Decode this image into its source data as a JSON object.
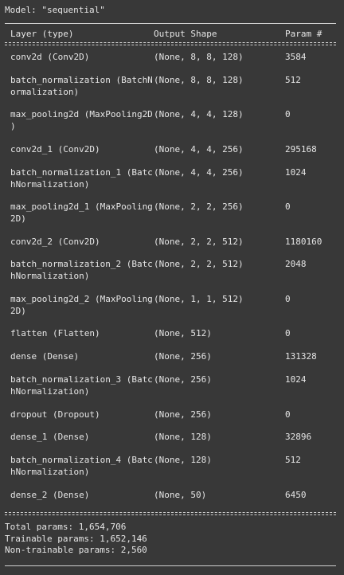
{
  "model_line": "Model: \"sequential\"",
  "headers": {
    "layer": "Layer (type)",
    "shape": "Output Shape",
    "param": "Param #"
  },
  "layers": [
    {
      "name": "conv2d (Conv2D)",
      "shape": "(None, 8, 8, 128)",
      "param": "3584"
    },
    {
      "name": "batch_normalization (BatchN\normalization)",
      "shape": "(None, 8, 8, 128)",
      "param": "512"
    },
    {
      "name": "max_pooling2d (MaxPooling2D\n)",
      "shape": "(None, 4, 4, 128)",
      "param": "0"
    },
    {
      "name": "conv2d_1 (Conv2D)",
      "shape": "(None, 4, 4, 256)",
      "param": "295168"
    },
    {
      "name": "batch_normalization_1 (Batc\nhNormalization)",
      "shape": "(None, 4, 4, 256)",
      "param": "1024"
    },
    {
      "name": "max_pooling2d_1 (MaxPooling\n2D)",
      "shape": "(None, 2, 2, 256)",
      "param": "0"
    },
    {
      "name": "conv2d_2 (Conv2D)",
      "shape": "(None, 2, 2, 512)",
      "param": "1180160"
    },
    {
      "name": "batch_normalization_2 (Batc\nhNormalization)",
      "shape": "(None, 2, 2, 512)",
      "param": "2048"
    },
    {
      "name": "max_pooling2d_2 (MaxPooling\n2D)",
      "shape": "(None, 1, 1, 512)",
      "param": "0"
    },
    {
      "name": "flatten (Flatten)",
      "shape": "(None, 512)",
      "param": "0"
    },
    {
      "name": "dense (Dense)",
      "shape": "(None, 256)",
      "param": "131328"
    },
    {
      "name": "batch_normalization_3 (Batc\nhNormalization)",
      "shape": "(None, 256)",
      "param": "1024"
    },
    {
      "name": "dropout (Dropout)",
      "shape": "(None, 256)",
      "param": "0"
    },
    {
      "name": "dense_1 (Dense)",
      "shape": "(None, 128)",
      "param": "32896"
    },
    {
      "name": "batch_normalization_4 (Batc\nhNormalization)",
      "shape": "(None, 128)",
      "param": "512"
    },
    {
      "name": "dense_2 (Dense)",
      "shape": "(None, 50)",
      "param": "6450"
    }
  ],
  "totals": {
    "total": "Total params: 1,654,706",
    "trainable": "Trainable params: 1,652,146",
    "non_trainable": "Non-trainable params: 2,560"
  },
  "colors": {
    "background": "#383838",
    "text": "#e6e6e6",
    "rule": "#cfcfcf"
  }
}
